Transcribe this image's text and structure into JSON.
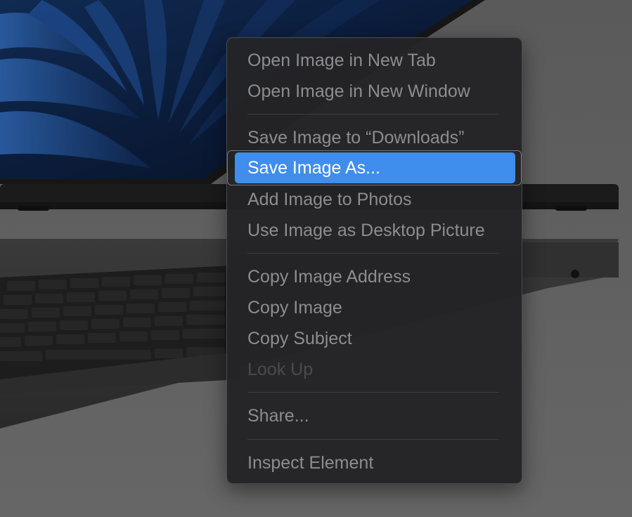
{
  "context_menu": {
    "items": [
      {
        "label": "Open Image in New Tab",
        "state": "normal"
      },
      {
        "label": "Open Image in New Window",
        "state": "normal"
      },
      {
        "label": "Save Image to “Downloads”",
        "state": "normal"
      },
      {
        "label": "Save Image As...",
        "state": "highlighted"
      },
      {
        "label": "Add Image to Photos",
        "state": "normal"
      },
      {
        "label": "Use Image as Desktop Picture",
        "state": "normal"
      },
      {
        "label": "Copy Image Address",
        "state": "normal"
      },
      {
        "label": "Copy Image",
        "state": "normal"
      },
      {
        "label": "Copy Subject",
        "state": "normal"
      },
      {
        "label": "Look Up",
        "state": "disabled"
      },
      {
        "label": "Share...",
        "state": "normal"
      },
      {
        "label": "Inspect Element",
        "state": "normal"
      }
    ],
    "highlight_color": "#3f8ded"
  },
  "background": {
    "subject": "MacBook laptop with blue wallpaper",
    "wallpaper_color": "#1b3a6e"
  }
}
